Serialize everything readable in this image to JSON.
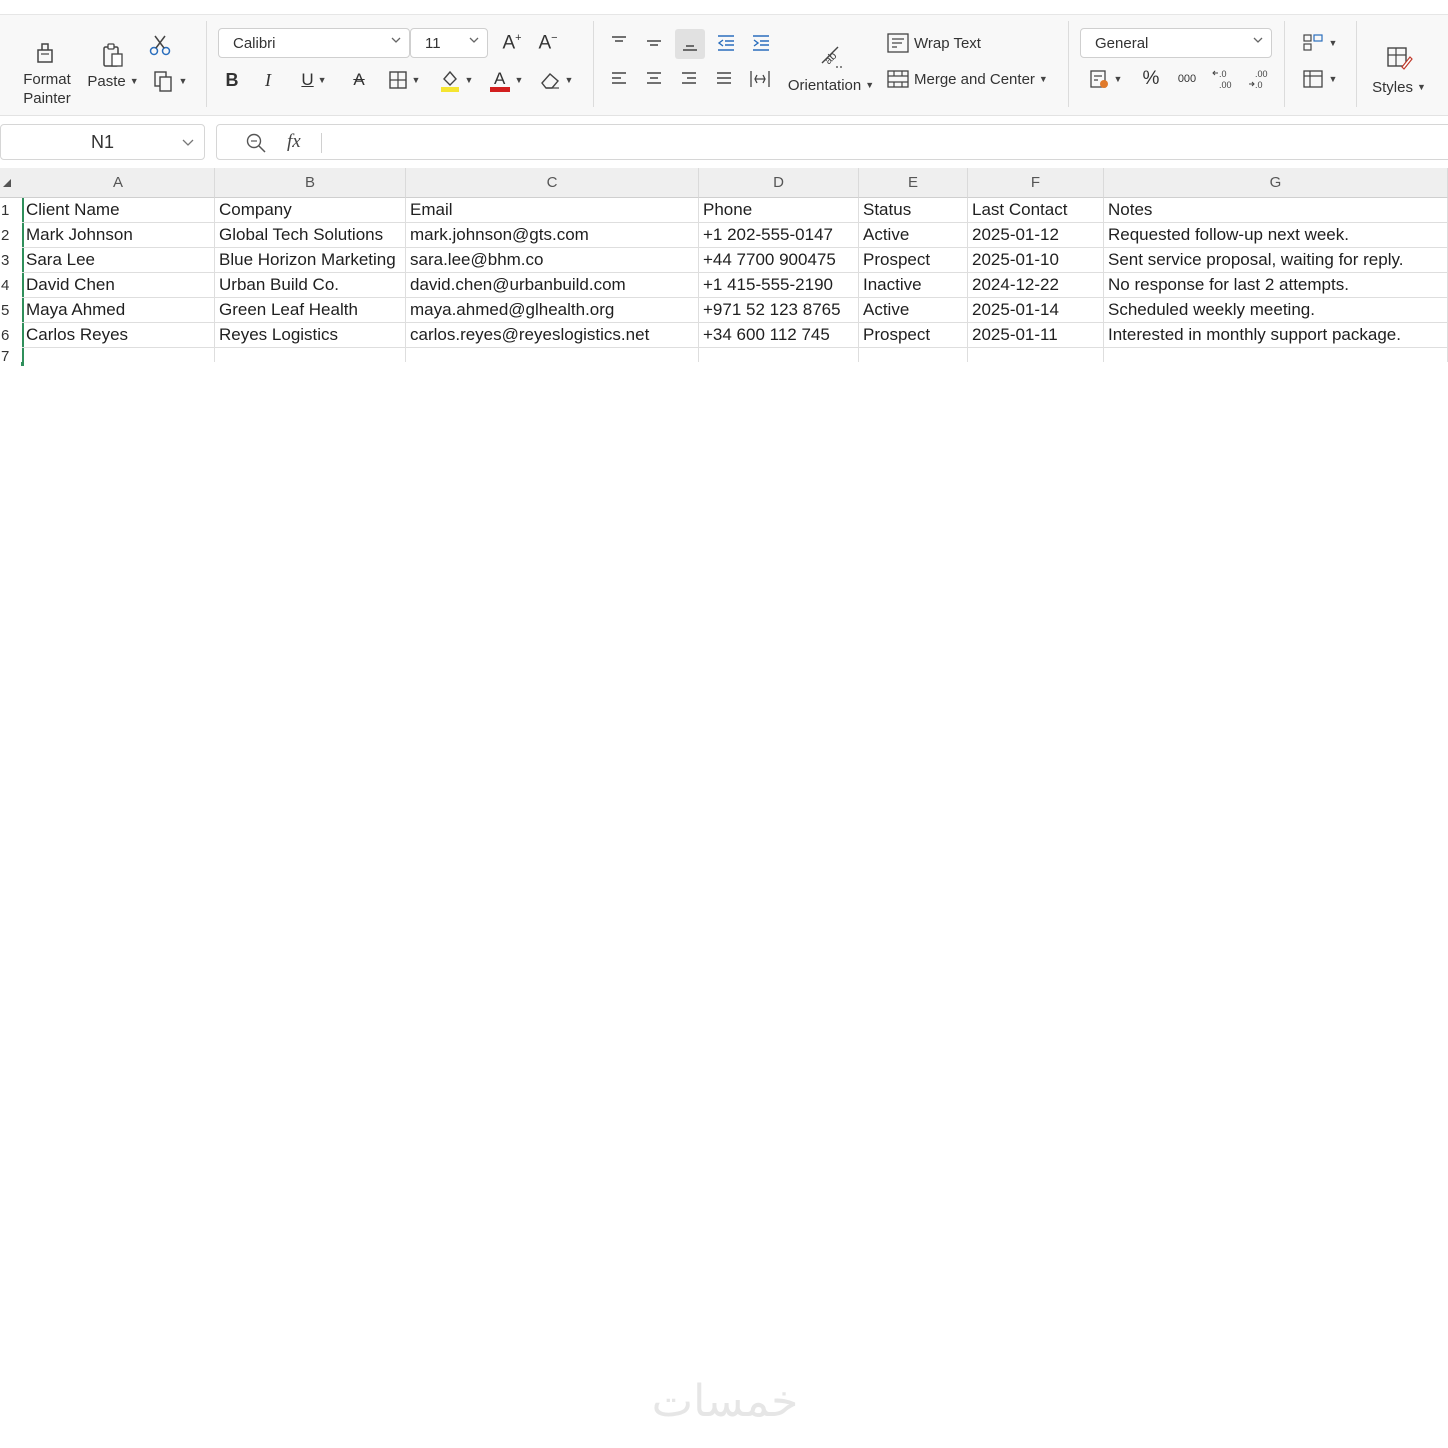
{
  "ribbon": {
    "clipboard": {
      "format_painter": "Format\nPainter",
      "paste": "Paste"
    },
    "font": {
      "family": "Calibri",
      "size": "11"
    },
    "alignment": {
      "wrap_text": "Wrap Text",
      "orientation": "Orientation",
      "merge_center": "Merge and Center"
    },
    "number": {
      "format": "General",
      "percent": "%",
      "thousands": "000"
    },
    "styles": {
      "label": "Styles"
    },
    "colors": {
      "highlight": "#f5e531",
      "font_color": "#d21f1f"
    }
  },
  "formula_bar": {
    "name_box": "N1",
    "fx": "fx",
    "value": ""
  },
  "sheet": {
    "columns": [
      "A",
      "B",
      "C",
      "D",
      "E",
      "F",
      "G"
    ],
    "row_numbers": [
      "1",
      "2",
      "3",
      "4",
      "5",
      "6",
      "7"
    ],
    "rows": [
      [
        "Client Name",
        "Company",
        "Email",
        "Phone",
        "Status",
        "Last Contact",
        "Notes"
      ],
      [
        "Mark Johnson",
        "Global Tech Solutions",
        "mark.johnson@gts.com",
        "+1 202-555-0147",
        "Active",
        "2025-01-12",
        "Requested follow-up next week."
      ],
      [
        "Sara Lee",
        "Blue Horizon Marketing",
        "sara.lee@bhm.co",
        "+44 7700 900475",
        "Prospect",
        "2025-01-10",
        "Sent service proposal, waiting for reply."
      ],
      [
        "David Chen",
        "Urban Build Co.",
        "david.chen@urbanbuild.com",
        "+1 415-555-2190",
        "Inactive",
        "2024-12-22",
        "No response for last 2 attempts."
      ],
      [
        "Maya Ahmed",
        "Green Leaf Health",
        "maya.ahmed@glhealth.org",
        "+971 52 123 8765",
        "Active",
        "2025-01-14",
        "Scheduled weekly meeting."
      ],
      [
        "Carlos Reyes",
        "Reyes Logistics",
        "carlos.reyes@reyeslogistics.net",
        "+34 600 112 745",
        "Prospect",
        "2025-01-11",
        "Interested in monthly support package."
      ]
    ]
  },
  "watermark": {
    "text": "خمسات"
  }
}
